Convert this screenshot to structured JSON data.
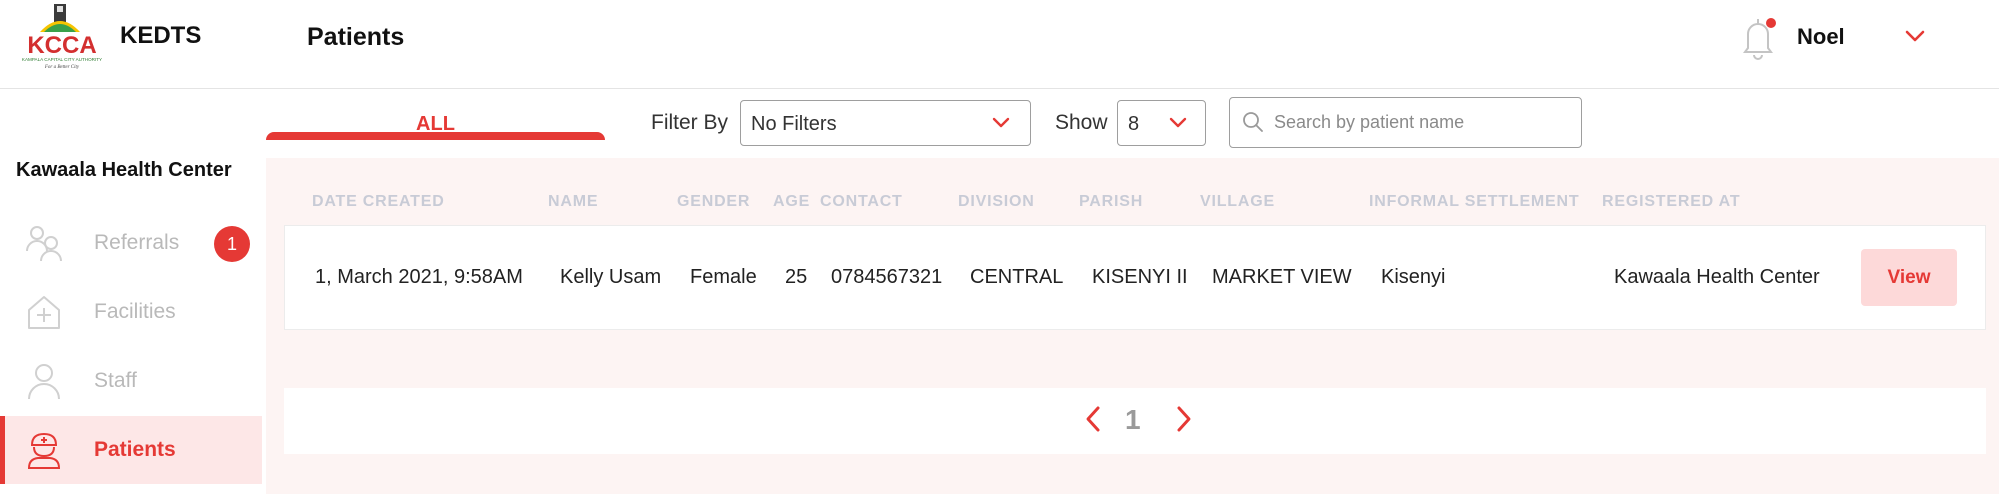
{
  "header": {
    "app_name": "KEDTS",
    "page_title": "Patients",
    "user_name": "Noel",
    "logo_text": "KCCA",
    "logo_subtext": "KAMPALA CAPITAL CITY AUTHORITY",
    "logo_tagline": "For a Better City"
  },
  "sidebar": {
    "facility_name": "Kawaala Health Center",
    "items": [
      {
        "label": "Referrals",
        "icon": "referrals-icon",
        "badge": "1",
        "active": false
      },
      {
        "label": "Facilities",
        "icon": "facility-icon",
        "active": false
      },
      {
        "label": "Staff",
        "icon": "staff-icon",
        "active": false
      },
      {
        "label": "Patients",
        "icon": "patient-icon",
        "active": true
      }
    ]
  },
  "toolbar": {
    "tab_all": "ALL",
    "filter_label": "Filter By",
    "filter_value": "No Filters",
    "show_label": "Show",
    "show_value": "8",
    "search_placeholder": "Search by patient name"
  },
  "table": {
    "columns": [
      "DATE CREATED",
      "NAME",
      "GENDER",
      "AGE",
      "CONTACT",
      "DIVISION",
      "PARISH",
      "VILLAGE",
      "INFORMAL SETTLEMENT",
      "REGISTERED AT"
    ],
    "rows": [
      {
        "date_created": "1, March 2021, 9:58AM",
        "name": "Kelly Usam",
        "gender": "Female",
        "age": "25",
        "contact": "0784567321",
        "division": "CENTRAL",
        "parish": "KISENYI II",
        "village": "MARKET VIEW",
        "informal_settlement": "Kisenyi",
        "registered_at": "Kawaala Health Center",
        "action": "View"
      }
    ]
  },
  "pagination": {
    "current_page": "1"
  },
  "colors": {
    "accent": "#e53935",
    "active_bg": "#fde7e7",
    "panel_bg": "#fdf4f3",
    "header_text": "#c8cbd6"
  }
}
